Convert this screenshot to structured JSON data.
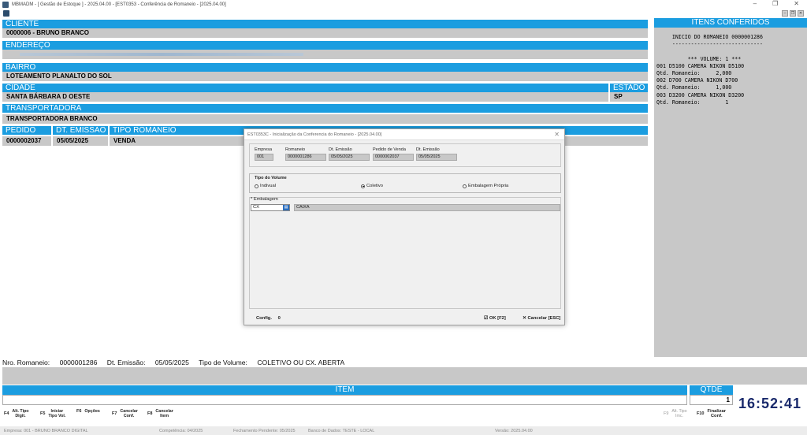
{
  "window": {
    "title": "MBMADM - [ Gestão de Estoque ] - 2025.04.00 - [EST0353 - Conferência de Romaneio - [2025.04.00]",
    "minimize": "–",
    "restore": "❐",
    "close": "✕"
  },
  "cliente": {
    "label": "CLIENTE",
    "value": "0000006 - BRUNO BRANCO"
  },
  "endereco": {
    "label": "ENDEREÇO",
    "value": ""
  },
  "bairro": {
    "label": "BAIRRO",
    "value": "LOTEAMENTO PLANALTO DO SOL"
  },
  "cidade": {
    "label": "CIDADE",
    "value": "SANTA BÁRBARA D OESTE"
  },
  "estado": {
    "label": "ESTADO",
    "value": "SP"
  },
  "transportadora": {
    "label": "TRANSPORTADORA",
    "value": "TRANSPORTADORA BRANCO"
  },
  "pedido": {
    "label": "PEDIDO",
    "value": "0000002037"
  },
  "dt_emissao": {
    "label": "DT. EMISSÃO",
    "value": "05/05/2025"
  },
  "tipo_romaneio": {
    "label": "TIPO ROMANEIO",
    "value": "VENDA"
  },
  "itens_conferidos": {
    "title": "ITENS CONFERIDOS",
    "lines": [
      "     INICIO DO ROMANEIO 0000001286",
      "     -----------------------------",
      "",
      "          *** VOLUME: 1 ***",
      "001 D5100 CAMERA NIKON D5100",
      "Qtd. Romaneio:     2,000",
      "002 D700 CAMERA NIKON D700",
      "Qtd. Romaneio:     1,000",
      "003 D3200 CAMERA NIKON D3200",
      "Qtd. Romaneio:        1"
    ]
  },
  "dialog": {
    "title": "EST0353C - Inicialização da Conferencia do Romaneio - [2025.04.00]",
    "close": "✕",
    "fields": {
      "empresa_label": "Empresa",
      "empresa_value": "001",
      "romaneio_label": "Romaneio",
      "romaneio_value": "0000001286",
      "dt_emissao_label": "Dt. Emissão",
      "dt_emissao_value": "05/05/2025",
      "pedido_label": "Pedido de Venda",
      "pedido_value": "0000002037",
      "dt_emissao2_label": "Dt. Emissão",
      "dt_emissao2_value": "05/05/2025"
    },
    "tipo_volume": {
      "legend": "Tipo do Volume",
      "options": [
        "Indivual",
        "Coletivo",
        "Embalagem Própria"
      ],
      "selected": "Coletivo"
    },
    "embalagem": {
      "label": "* Embalagem",
      "code": "CX",
      "description": "CAIXA"
    },
    "config_label": "Config.",
    "config_value": "0",
    "ok_label": "OK [F2]",
    "cancel_label": "Cancelar [ESC]"
  },
  "romaneio_info": {
    "nro_label": "Nro. Romaneio:",
    "nro_value": "0000001286",
    "dt_label": "Dt. Emissão:",
    "dt_value": "05/05/2025",
    "tipo_label": "Tipo de Volume:",
    "tipo_value": "COLETIVO OU CX. ABERTA"
  },
  "item": {
    "label": "ITEM"
  },
  "qtde": {
    "label": "QTDE",
    "value": "1"
  },
  "clock": "16:52:41",
  "fkeys": [
    {
      "key": "F4",
      "desc": "Alt. Tipo\nDigit."
    },
    {
      "key": "F5",
      "desc": "Iniciar\nTipo Vol."
    },
    {
      "key": "F6",
      "desc": "Opções"
    },
    {
      "key": "F7",
      "desc": "Cancelar\nConf."
    },
    {
      "key": "F8",
      "desc": "Cancelar\nItem"
    },
    {
      "key": "F9",
      "desc": "Alt. Tipo\nImc."
    },
    {
      "key": "F10",
      "desc": "Finalizar\nConf."
    }
  ],
  "statusbar": {
    "empresa": "Empresa: 001 - BRUNO BRANCO DIGITAL",
    "competencia": "Competência: 04/2025",
    "fechamento": "Fechamento Pendente: 05/2025",
    "banco": "Banco de Dados: TESTE - LOCAL",
    "versao": "Versão: 2025.04.00"
  },
  "colors": {
    "header_blue": "#1b9de0",
    "field_gray": "#c8c8c8",
    "clock_navy": "#1a2a6c"
  }
}
